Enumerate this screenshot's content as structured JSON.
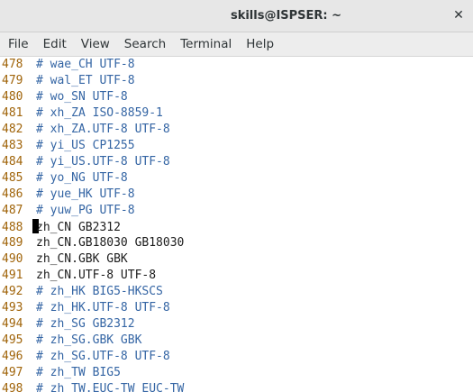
{
  "window": {
    "title": "skills@ISPSER: ~",
    "close_glyph": "✕"
  },
  "menu": [
    {
      "label": "File"
    },
    {
      "label": "Edit"
    },
    {
      "label": "View"
    },
    {
      "label": "Search"
    },
    {
      "label": "Terminal"
    },
    {
      "label": "Help"
    }
  ],
  "lines": [
    {
      "num": "478",
      "text": "# wae_CH UTF-8",
      "commented": true
    },
    {
      "num": "479",
      "text": "# wal_ET UTF-8",
      "commented": true
    },
    {
      "num": "480",
      "text": "# wo_SN UTF-8",
      "commented": true
    },
    {
      "num": "481",
      "text": "# xh_ZA ISO-8859-1",
      "commented": true
    },
    {
      "num": "482",
      "text": "# xh_ZA.UTF-8 UTF-8",
      "commented": true
    },
    {
      "num": "483",
      "text": "# yi_US CP1255",
      "commented": true
    },
    {
      "num": "484",
      "text": "# yi_US.UTF-8 UTF-8",
      "commented": true
    },
    {
      "num": "485",
      "text": "# yo_NG UTF-8",
      "commented": true
    },
    {
      "num": "486",
      "text": "# yue_HK UTF-8",
      "commented": true
    },
    {
      "num": "487",
      "text": "# yuw_PG UTF-8",
      "commented": true
    },
    {
      "num": "488",
      "text": "zh_CN GB2312",
      "commented": false,
      "cursor": true
    },
    {
      "num": "489",
      "text": "zh_CN.GB18030 GB18030",
      "commented": false
    },
    {
      "num": "490",
      "text": "zh_CN.GBK GBK",
      "commented": false
    },
    {
      "num": "491",
      "text": "zh_CN.UTF-8 UTF-8",
      "commented": false
    },
    {
      "num": "492",
      "text": "# zh_HK BIG5-HKSCS",
      "commented": true
    },
    {
      "num": "493",
      "text": "# zh_HK.UTF-8 UTF-8",
      "commented": true
    },
    {
      "num": "494",
      "text": "# zh_SG GB2312",
      "commented": true
    },
    {
      "num": "495",
      "text": "# zh_SG.GBK GBK",
      "commented": true
    },
    {
      "num": "496",
      "text": "# zh_SG.UTF-8 UTF-8",
      "commented": true
    },
    {
      "num": "497",
      "text": "# zh_TW BIG5",
      "commented": true
    },
    {
      "num": "498",
      "text": "# zh_TW.EUC-TW EUC-TW",
      "commented": true
    }
  ],
  "colors": {
    "line_number": "#a0640a",
    "comment": "#3465a4",
    "text": "#1c1c1c",
    "cursor": "#000000"
  }
}
